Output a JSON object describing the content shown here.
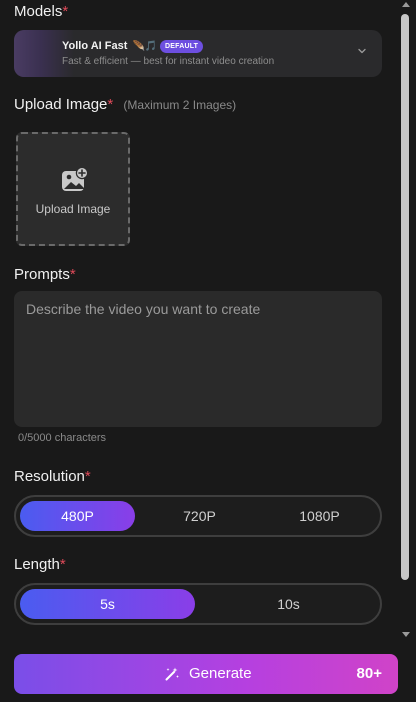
{
  "models": {
    "label": "Models",
    "required": "*",
    "selected": {
      "title": "Yollo AI Fast",
      "emoji": "🪶🎵",
      "badge": "DEFAULT",
      "description": "Fast & efficient — best for instant video creation"
    }
  },
  "upload": {
    "label": "Upload Image",
    "required": "*",
    "hint": "(Maximum 2 Images)",
    "button_text": "Upload Image"
  },
  "prompts": {
    "label": "Prompts",
    "required": "*",
    "placeholder": "Describe the video you want to create",
    "value": "",
    "char_count": "0/5000 characters"
  },
  "resolution": {
    "label": "Resolution",
    "required": "*",
    "options": [
      "480P",
      "720P",
      "1080P"
    ],
    "selected": "480P"
  },
  "length": {
    "label": "Length",
    "required": "*",
    "options": [
      "5s",
      "10s"
    ],
    "selected": "5s"
  },
  "generate": {
    "label": "Generate",
    "cost": "80+",
    "icon": "magic-wand-icon"
  },
  "colors": {
    "background": "#191919",
    "required_mark": "#e04a5a",
    "badge": "#6d4fe0",
    "accent_start": "#4a5cf0",
    "accent_end": "#8a3ee8",
    "generate_end": "#d043c8"
  }
}
